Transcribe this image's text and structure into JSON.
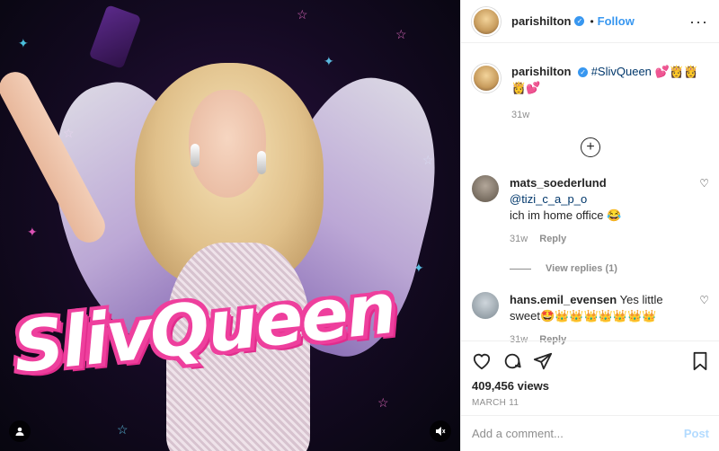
{
  "media": {
    "overlay_text": "SlivQueen",
    "icons": [
      "user-tag-icon",
      "sound-icon"
    ]
  },
  "header": {
    "username": "parishilton",
    "verified": true,
    "follow_label": "Follow",
    "more_icon": "ellipsis-icon"
  },
  "caption": {
    "username": "parishilton",
    "text": "#SlivQueen 💕👸👸",
    "text2": "👸💕",
    "age": "31w"
  },
  "comments": [
    {
      "username": "mats_soederlund",
      "mention": "@tizi_c_a_p_o",
      "text": "ich im home office 😂",
      "age": "31w",
      "reply_label": "Reply"
    },
    {
      "username": "hans.emil_evensen",
      "text": "Yes little sweet🤩👑👑👑👑👑👑👑",
      "age": "31w",
      "reply_label": "Reply"
    }
  ],
  "view_replies": "View replies (1)",
  "stats": {
    "views": "409,456 views",
    "date": "MARCH 11"
  },
  "composer": {
    "placeholder": "Add a comment...",
    "post_label": "Post"
  },
  "colors": {
    "accent": "#3897f0",
    "pink": "#ee3f9d",
    "muted": "#8e8e8e"
  }
}
